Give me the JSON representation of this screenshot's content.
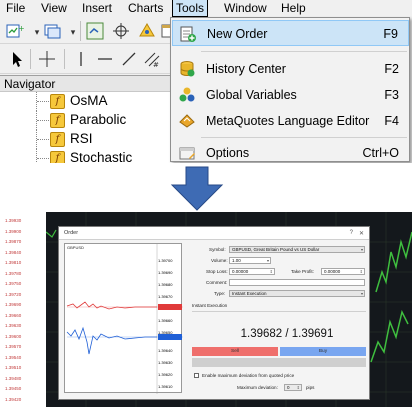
{
  "menubar": {
    "items": [
      "File",
      "View",
      "Insert",
      "Charts",
      "Tools",
      "Window",
      "Help"
    ],
    "active_item": "Tools"
  },
  "navigator": {
    "title": "Navigator",
    "items": [
      "OsMA",
      "Parabolic",
      "RSI",
      "Stochastic"
    ]
  },
  "tools_menu": {
    "items": [
      {
        "label": "New Order",
        "shortcut": "F9",
        "icon": "new-order-icon",
        "highlighted": true
      },
      {
        "label": "History Center",
        "shortcut": "F2",
        "icon": "history-center-icon"
      },
      {
        "label": "Global Variables",
        "shortcut": "F3",
        "icon": "global-variables-icon"
      },
      {
        "label": "MetaQuotes Language Editor",
        "shortcut": "F4",
        "icon": "language-editor-icon"
      },
      {
        "label": "Options",
        "shortcut": "Ctrl+O",
        "icon": "options-icon"
      }
    ]
  },
  "arrow": {
    "icon": "down-arrow-icon",
    "color": "#3e6bb4"
  },
  "order_window": {
    "title": "Order",
    "mini_chart": {
      "symbol": "GBPUSD",
      "price_ticks": [
        "1.39700",
        "1.39690",
        "1.39680",
        "1.39670",
        "1.39660",
        "1.39650",
        "1.39640",
        "1.39630",
        "1.39620",
        "1.39610"
      ],
      "bid_color": "#1f5fd6",
      "ask_color": "#e03a3a"
    },
    "form": {
      "symbol_label": "Symbol:",
      "symbol_value": "GBPUSD, Great Britain Pound vs US Dollar",
      "volume_label": "Volume:",
      "volume_value": "1.00",
      "stop_loss_label": "Stop Loss:",
      "stop_loss_value": "0.00000",
      "take_profit_label": "Take Profit:",
      "take_profit_value": "0.00000",
      "comment_label": "Comment:",
      "comment_value": "",
      "type_label": "Type:",
      "type_value": "Instant Execution",
      "section_title": "Instant Execution"
    },
    "price_display": "1.39682 / 1.39691",
    "sell_label": "Sell",
    "buy_label": "Buy",
    "sell_color": "#ef6f6c",
    "buy_color": "#79a6f0",
    "deviation_checkbox_label": "Enable maximum deviation from quoted price",
    "max_deviation_label": "Maximum deviation:",
    "max_deviation_value": "0",
    "max_deviation_unit": "pips"
  },
  "background_chart": {
    "left_prices": [
      "1.39930",
      "1.39900",
      "1.39870",
      "1.39840",
      "1.39810",
      "1.39780",
      "1.39750",
      "1.39720",
      "1.39690",
      "1.39660",
      "1.39630",
      "1.39600",
      "1.39570",
      "1.39540",
      "1.39510",
      "1.39480",
      "1.39450",
      "1.39420"
    ]
  }
}
